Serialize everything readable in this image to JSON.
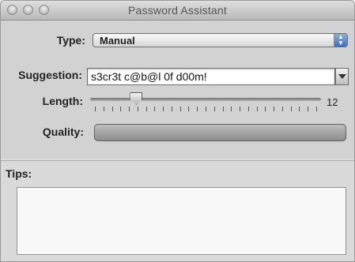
{
  "window": {
    "title": "Password Assistant"
  },
  "form": {
    "type_label": "Type:",
    "type_value": "Manual",
    "suggestion_label": "Suggestion:",
    "suggestion_value": "s3cr3t c@b@l 0f d00m!",
    "length_label": "Length:",
    "length_value": "12",
    "length_fraction": 0.2,
    "quality_label": "Quality:",
    "quality_fraction": 0.0
  },
  "tips": {
    "label": "Tips:",
    "text": ""
  },
  "icons": {
    "popup_arrows": "up-down-arrows-icon",
    "combo_arrow": "chevron-down-icon"
  }
}
